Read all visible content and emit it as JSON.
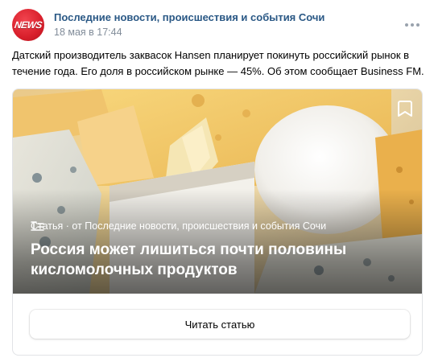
{
  "post": {
    "avatar_logo_text": "NEWS",
    "author": "Последние новости, происшествия и события Сочи",
    "date": "18 мая в 17:44",
    "text": "Датский производитель заквасок Hansen планирует покинуть российский рынок в течение года. Его доля в российском рынке — 45%. Об этом сообщает Business FM."
  },
  "article": {
    "meta": "Статья · от Последние новости, происшествия и события Сочи",
    "title": "Россия может лишиться почти половины кисломолочных продуктов",
    "read_button": "Читать статью"
  },
  "icons": {
    "more": "more-dots-icon",
    "bookmark": "bookmark-icon",
    "article": "article-icon"
  },
  "colors": {
    "author_link": "#2a5885",
    "date": "#818c99",
    "avatar": "#d81f2b"
  }
}
